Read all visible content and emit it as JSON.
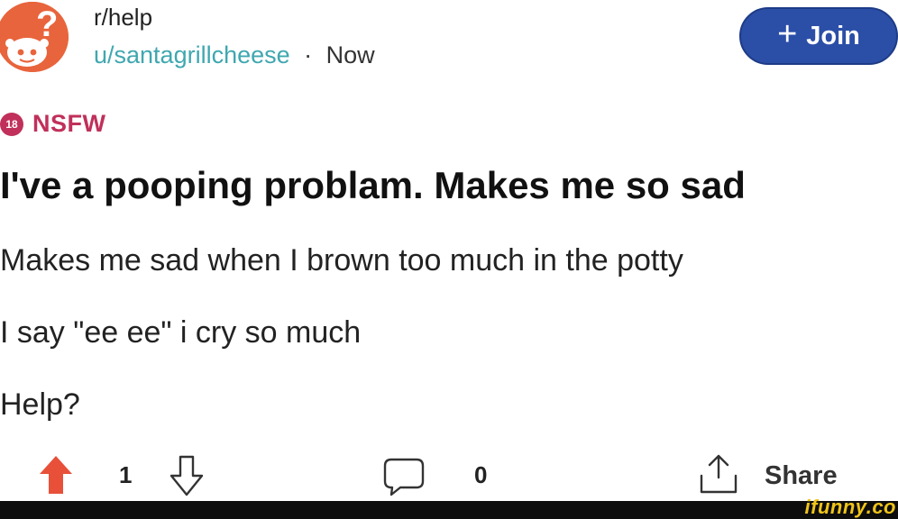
{
  "post": {
    "subreddit": "r/help",
    "author": "u/santagrillcheese",
    "separator": "·",
    "time": "Now",
    "join_label": "Join",
    "join_icon": "plus-icon",
    "nsfw_badge": "18",
    "nsfw_label": "NSFW",
    "title": "I've a pooping problam. Makes me so sad",
    "body": [
      "Makes me sad when I brown too much in the potty",
      "I say \"ee ee\" i cry so much",
      "Help?"
    ],
    "score": "1",
    "comments": "0",
    "share_label": "Share"
  },
  "icons": {
    "subreddit": "subreddit-help-icon",
    "upvote": "upvote-arrow-icon",
    "downvote": "downvote-arrow-icon",
    "comment": "comment-bubble-icon",
    "share": "share-icon"
  },
  "colors": {
    "subreddit_icon": "#e8643c",
    "join_button": "#2b4fa7",
    "username": "#3fa7b0",
    "nsfw": "#c0305a",
    "upvote": "#e8503a",
    "watermark": "#f0c419"
  },
  "watermark": "ifunny.co"
}
